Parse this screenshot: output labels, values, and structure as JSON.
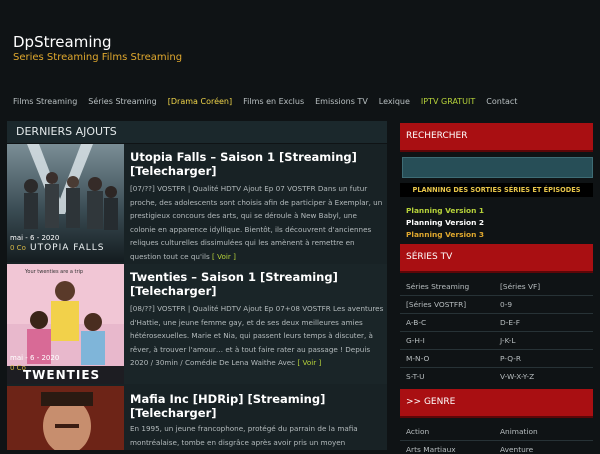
{
  "header": {
    "title": "DpStreaming",
    "tagline": "Series Streaming Films Streaming"
  },
  "nav": {
    "items": [
      "Films Streaming",
      "Séries Streaming",
      "[Drama Coréen]",
      "Films en Exclus",
      "Emissions TV",
      "Lexique",
      "IPTV GRATUIT",
      "Contact"
    ]
  },
  "main": {
    "heading": "DERNIERS AJOUTS",
    "posts": [
      {
        "title": "Utopia Falls – Saison 1 [Streaming] [Telecharger]",
        "excerpt": "[07/??] VOSTFR | Qualité HDTV Ajout Ep 07 VOSTFR Dans un futur proche, des adolescents sont choisis afin de participer à Exemplar, un prestigieux concours des arts, qui se déroule à New Babyl, une colonie en apparence idyllique. Bientôt, ils découvrent d'anciennes reliques culturelles dissimulées qui les amènent à remettre en question tout ce qu'ils",
        "more": "[ Voir ]",
        "date": "mai - 6 - 2020",
        "comments": "0 Co",
        "poster_text": "UTOPIA FALLS"
      },
      {
        "title": "Twenties – Saison 1 [Streaming] [Telecharger]",
        "excerpt": "[08/??] VOSTFR | Qualité HDTV Ajout Ep 07+08 VOSTFR Les aventures d'Hattie, une jeune femme gay, et de ses deux meilleures amies hétérosexuelles. Marie et Nia, qui passent leurs temps à discuter, à rêver, à trouver l'amour… et à tout faire rater au passage ! Depuis 2020 / 30min / Comédie De Lena Waithe Avec",
        "more": "[ Voir ]",
        "date": "mai - 6 - 2020",
        "comments": "0 Co",
        "poster_text": "TWENTIES",
        "poster_tagline": "Your twenties are a trip"
      },
      {
        "title": "Mafia Inc [HDRip] [Streaming] [Telecharger]",
        "excerpt": "En 1995, un jeune francophone, protégé du parrain de la mafia montréalaise, tombe en disgrâce après avoir pris un moyen"
      }
    ]
  },
  "sidebar": {
    "search_heading": "RECHERCHER",
    "planning_heading": "PLANNING DES SORTIES SÉRIES ET ÉPISODES",
    "planning": [
      "Planning Version 1",
      "Planning Version 2",
      "Planning Version 3"
    ],
    "series_heading": "SÉRIES TV",
    "series_links": [
      [
        "Séries Streaming",
        "[Séries VF]"
      ],
      [
        "[Séries VOSTFR]",
        "0-9"
      ],
      [
        "A-B-C",
        "D-E-F"
      ],
      [
        "G-H-I",
        "J-K-L"
      ],
      [
        "M-N-O",
        "P-Q-R"
      ],
      [
        "S-T-U",
        "V-W-X-Y-Z"
      ]
    ],
    "genre_heading": ">> GENRE",
    "genre_links": [
      [
        "Action",
        "Animation"
      ],
      [
        "Arts Martiaux",
        "Aventure"
      ]
    ]
  },
  "colors": {
    "accent_red": "#a90f12",
    "planning_1": "#b7d33a",
    "planning_2": "#ffffff",
    "planning_3": "#e0a82e",
    "nav_highlight": "#f0d54a",
    "nav_iptv": "#b7d33a"
  }
}
